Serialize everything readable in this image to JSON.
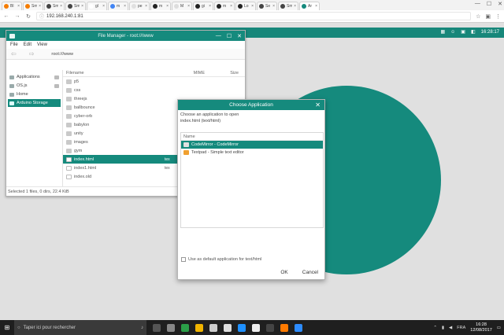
{
  "browser": {
    "tabs": [
      {
        "label": "Bl",
        "color": "#f57c00",
        "active": false
      },
      {
        "label": "Sm",
        "color": "#f57c00",
        "active": false
      },
      {
        "label": "Sm",
        "color": "#444444",
        "active": false
      },
      {
        "label": "Sm",
        "color": "#444444",
        "active": false
      },
      {
        "label": "gl",
        "color": "#ffffff",
        "active": false
      },
      {
        "label": "m",
        "color": "#4285f4",
        "active": false
      },
      {
        "label": "pe",
        "color": "#e0e0e0",
        "active": false
      },
      {
        "label": "m",
        "color": "#222222",
        "active": false
      },
      {
        "label": "M",
        "color": "#dddddd",
        "active": false
      },
      {
        "label": "gi",
        "color": "#222222",
        "active": false
      },
      {
        "label": "m",
        "color": "#222222",
        "active": false
      },
      {
        "label": "Lo",
        "color": "#222222",
        "active": false
      },
      {
        "label": "Se",
        "color": "#444444",
        "active": false
      },
      {
        "label": "Sm",
        "color": "#444444",
        "active": false
      },
      {
        "label": "Ar",
        "color": "#158a7d",
        "active": true
      }
    ],
    "url": "192.168.240.1:81",
    "window_controls": {
      "minimize": "—",
      "maximize": "☐",
      "close": "✕"
    }
  },
  "desktop": {
    "accent": "#158a7d",
    "time": "16:28:17"
  },
  "file_manager": {
    "title": "File Manager - root:///www",
    "menu": [
      "File",
      "Edit",
      "View"
    ],
    "path": "root:///www",
    "sidebar": [
      {
        "label": "Applications",
        "active": false,
        "eject": true
      },
      {
        "label": "OS.js",
        "active": false,
        "eject": true
      },
      {
        "label": "Home",
        "active": false,
        "eject": false
      },
      {
        "label": "Arduino Storage",
        "active": true,
        "eject": false
      }
    ],
    "columns": {
      "filename": "Filename",
      "mime": "MIME",
      "size": "Size"
    },
    "rows": [
      {
        "name": "p5",
        "type": "folder",
        "selected": false,
        "extra": ""
      },
      {
        "name": "css",
        "type": "folder",
        "selected": false,
        "extra": ""
      },
      {
        "name": "threejs",
        "type": "folder",
        "selected": false,
        "extra": ""
      },
      {
        "name": "ballbounce",
        "type": "folder",
        "selected": false,
        "extra": ""
      },
      {
        "name": "cyber-orb",
        "type": "folder",
        "selected": false,
        "extra": ""
      },
      {
        "name": "babylon",
        "type": "folder",
        "selected": false,
        "extra": ""
      },
      {
        "name": "unity",
        "type": "folder",
        "selected": false,
        "extra": ""
      },
      {
        "name": "images",
        "type": "folder",
        "selected": false,
        "extra": ""
      },
      {
        "name": "gym",
        "type": "folder",
        "selected": false,
        "extra": ""
      },
      {
        "name": "index.html",
        "type": "file",
        "selected": true,
        "extra": "tex"
      },
      {
        "name": "index1.html",
        "type": "file",
        "selected": false,
        "extra": "tex"
      },
      {
        "name": "index.old",
        "type": "file",
        "selected": false,
        "extra": ""
      }
    ],
    "status": "Selected 1 files, 0 dirs, 22.4 KiB"
  },
  "dialog": {
    "title": "Choose Application",
    "description": "Choose an application to open",
    "file": "index.html (text/html)",
    "column": "Name",
    "apps": [
      {
        "label": "CodeMirror - CodeMirror",
        "selected": true,
        "color": "#e0e0e0"
      },
      {
        "label": "Textpad - Simple text editor",
        "selected": false,
        "color": "#f0a030"
      }
    ],
    "default_label": "Use as default application for text/html",
    "ok": "OK",
    "cancel": "Cancel"
  },
  "taskbar": {
    "search_placeholder": "Taper ici pour rechercher",
    "apps": [
      "#555555",
      "#888888",
      "#2b9f48",
      "#f0b400",
      "#cccccc",
      "#dddddd",
      "#1e90ff",
      "#eeeeee",
      "#444444",
      "#ff7a00",
      "#2d8cff"
    ],
    "lang": "FRA",
    "time": "16:28",
    "date": "12/08/2017"
  }
}
